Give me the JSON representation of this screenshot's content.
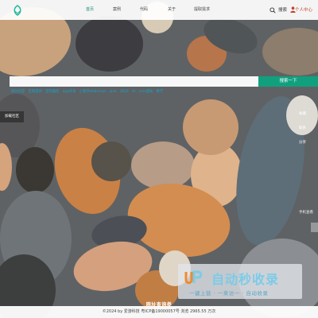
{
  "header": {
    "logo_icon": "leaf-logo",
    "nav": [
      "首页",
      "案例",
      "代码",
      "关于",
      "提取需求"
    ],
    "active_nav": 0,
    "search_label": "搜索",
    "user_label": "个人中心"
  },
  "search": {
    "placeholder": "",
    "button_label": "搜索一下",
    "hot_tags": [
      "网站也是",
      "定制案例",
      "定制服务",
      "app开发",
      "小程序webscout",
      "java",
      "2024",
      "AI",
      "cms建站",
      "数学"
    ]
  },
  "side": {
    "left_tab": "加载社区",
    "right_links": [
      "收藏",
      "联系",
      "分享"
    ],
    "mobile_label": "手机查看"
  },
  "footer": {
    "title": "网址查询类",
    "copyright": "©2024 by 爱游科技 粤ICP备19000057号 浏览 2965.55 万次"
  },
  "watermark": {
    "title": "自动秒收录",
    "slogan": "一键上链 · 一来访一 · 自动收录"
  },
  "colors": {
    "accent": "#11a07e",
    "link": "#0ea5d3",
    "user": "#c5412e"
  }
}
